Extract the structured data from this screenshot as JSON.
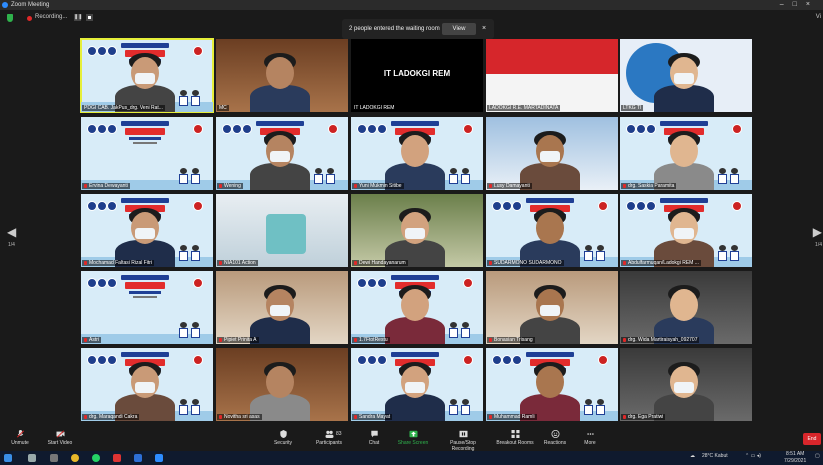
{
  "window": {
    "title": "Zoom Meeting"
  },
  "topbar": {
    "recording_label": "Recording...",
    "view_label": "Vi"
  },
  "waiting_banner": {
    "text": "2 people entered the waiting room",
    "view_button": "View",
    "close": "×"
  },
  "pager": {
    "left_page": "1/4",
    "right_page": "1/4"
  },
  "participants": [
    {
      "name": "PDGI CAB. JakPus_drg. Veni Rat...",
      "scene": "webinar-person",
      "speaker": true,
      "muted": false
    },
    {
      "name": "MC",
      "scene": "room",
      "muted": false
    },
    {
      "name": "IT LADOKGI REM",
      "scene": "black",
      "muted": false
    },
    {
      "name": "LADOKGI R.E. MARTADINATA",
      "scene": "flag",
      "muted": false
    },
    {
      "name": "LTKG TI",
      "scene": "logo-person",
      "muted": false
    },
    {
      "name": "Ervina Dewayanti",
      "scene": "webinar",
      "muted": true
    },
    {
      "name": "Wening",
      "scene": "webinar-person",
      "muted": true
    },
    {
      "name": "Yuni Mukmin Sitibe",
      "scene": "webinar-person",
      "muted": true
    },
    {
      "name": "Lusy Damayanti",
      "scene": "sky-person",
      "muted": true
    },
    {
      "name": "drg. Saskia Paramita",
      "scene": "webinar-person",
      "muted": true
    },
    {
      "name": "Mochamad Faltasi Rizal Fitri",
      "scene": "webinar-person",
      "muted": true
    },
    {
      "name": "NIA101 Action",
      "scene": "clinic",
      "muted": true
    },
    {
      "name": "Dewi Handayanarum",
      "scene": "outdoor-person",
      "muted": true
    },
    {
      "name": "SUDARMONO SUDARMONO",
      "scene": "webinar-person",
      "muted": true
    },
    {
      "name": "Abdulfarmuqan/Ladokgi REM ...",
      "scene": "webinar-person",
      "muted": true
    },
    {
      "name": "Astri",
      "scene": "webinar",
      "muted": true
    },
    {
      "name": "Pipiet Prinita A",
      "scene": "room-person",
      "muted": true
    },
    {
      "name": "1.7FtotRestu",
      "scene": "webinar-person",
      "muted": true
    },
    {
      "name": "Bonasian Trisang",
      "scene": "room-person",
      "muted": true
    },
    {
      "name": "drg. Wida Martiraisyah_092707",
      "scene": "dark-person",
      "muted": true
    },
    {
      "name": "drg. Maraqandi Cakra",
      "scene": "webinar-person",
      "muted": true
    },
    {
      "name": "Novitha sri asas",
      "scene": "room",
      "muted": true
    },
    {
      "name": "Sandra Mayat",
      "scene": "webinar-person",
      "muted": true
    },
    {
      "name": "Muhammad Ramli",
      "scene": "webinar-person",
      "muted": true
    },
    {
      "name": "drg. Ega Pratiwi",
      "scene": "dark-person",
      "muted": true
    }
  ],
  "toolbar": {
    "unmute": "Unmute",
    "start_video": "Start Video",
    "security": "Security",
    "participants": "Participants",
    "participants_count": "83",
    "chat": "Chat",
    "share_screen": "Share Screen",
    "pause_recording": "Pause/Stop Recording",
    "breakout_rooms": "Breakout Rooms",
    "reactions": "Reactions",
    "more": "More",
    "end": "End"
  },
  "taskbar": {
    "weather": "28°C  Kabut",
    "clock_time": "8:51 AM",
    "clock_date": "7/29/2021"
  },
  "colors": {
    "accent": "#2d8cff",
    "end": "#d9262b",
    "speaker_outline": "#e6ef3a",
    "share": "#2fb24c"
  }
}
